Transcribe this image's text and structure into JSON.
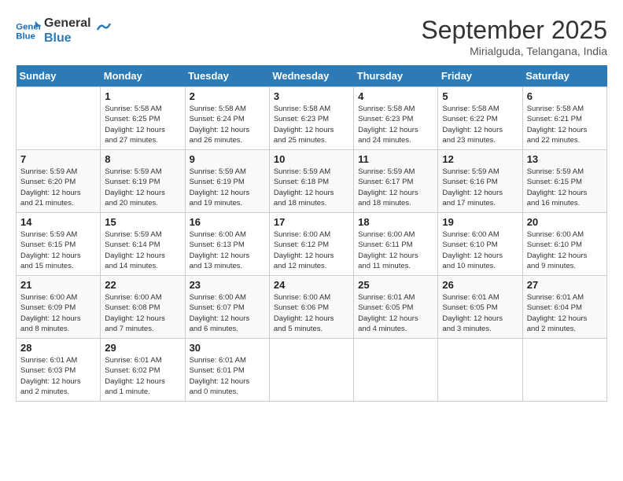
{
  "header": {
    "logo_line1": "General",
    "logo_line2": "Blue",
    "month": "September 2025",
    "location": "Mirialguda, Telangana, India"
  },
  "columns": [
    "Sunday",
    "Monday",
    "Tuesday",
    "Wednesday",
    "Thursday",
    "Friday",
    "Saturday"
  ],
  "weeks": [
    [
      {
        "day": "",
        "info": ""
      },
      {
        "day": "1",
        "info": "Sunrise: 5:58 AM\nSunset: 6:25 PM\nDaylight: 12 hours\nand 27 minutes."
      },
      {
        "day": "2",
        "info": "Sunrise: 5:58 AM\nSunset: 6:24 PM\nDaylight: 12 hours\nand 26 minutes."
      },
      {
        "day": "3",
        "info": "Sunrise: 5:58 AM\nSunset: 6:23 PM\nDaylight: 12 hours\nand 25 minutes."
      },
      {
        "day": "4",
        "info": "Sunrise: 5:58 AM\nSunset: 6:23 PM\nDaylight: 12 hours\nand 24 minutes."
      },
      {
        "day": "5",
        "info": "Sunrise: 5:58 AM\nSunset: 6:22 PM\nDaylight: 12 hours\nand 23 minutes."
      },
      {
        "day": "6",
        "info": "Sunrise: 5:58 AM\nSunset: 6:21 PM\nDaylight: 12 hours\nand 22 minutes."
      }
    ],
    [
      {
        "day": "7",
        "info": "Sunrise: 5:59 AM\nSunset: 6:20 PM\nDaylight: 12 hours\nand 21 minutes."
      },
      {
        "day": "8",
        "info": "Sunrise: 5:59 AM\nSunset: 6:19 PM\nDaylight: 12 hours\nand 20 minutes."
      },
      {
        "day": "9",
        "info": "Sunrise: 5:59 AM\nSunset: 6:19 PM\nDaylight: 12 hours\nand 19 minutes."
      },
      {
        "day": "10",
        "info": "Sunrise: 5:59 AM\nSunset: 6:18 PM\nDaylight: 12 hours\nand 18 minutes."
      },
      {
        "day": "11",
        "info": "Sunrise: 5:59 AM\nSunset: 6:17 PM\nDaylight: 12 hours\nand 18 minutes."
      },
      {
        "day": "12",
        "info": "Sunrise: 5:59 AM\nSunset: 6:16 PM\nDaylight: 12 hours\nand 17 minutes."
      },
      {
        "day": "13",
        "info": "Sunrise: 5:59 AM\nSunset: 6:15 PM\nDaylight: 12 hours\nand 16 minutes."
      }
    ],
    [
      {
        "day": "14",
        "info": "Sunrise: 5:59 AM\nSunset: 6:15 PM\nDaylight: 12 hours\nand 15 minutes."
      },
      {
        "day": "15",
        "info": "Sunrise: 5:59 AM\nSunset: 6:14 PM\nDaylight: 12 hours\nand 14 minutes."
      },
      {
        "day": "16",
        "info": "Sunrise: 6:00 AM\nSunset: 6:13 PM\nDaylight: 12 hours\nand 13 minutes."
      },
      {
        "day": "17",
        "info": "Sunrise: 6:00 AM\nSunset: 6:12 PM\nDaylight: 12 hours\nand 12 minutes."
      },
      {
        "day": "18",
        "info": "Sunrise: 6:00 AM\nSunset: 6:11 PM\nDaylight: 12 hours\nand 11 minutes."
      },
      {
        "day": "19",
        "info": "Sunrise: 6:00 AM\nSunset: 6:10 PM\nDaylight: 12 hours\nand 10 minutes."
      },
      {
        "day": "20",
        "info": "Sunrise: 6:00 AM\nSunset: 6:10 PM\nDaylight: 12 hours\nand 9 minutes."
      }
    ],
    [
      {
        "day": "21",
        "info": "Sunrise: 6:00 AM\nSunset: 6:09 PM\nDaylight: 12 hours\nand 8 minutes."
      },
      {
        "day": "22",
        "info": "Sunrise: 6:00 AM\nSunset: 6:08 PM\nDaylight: 12 hours\nand 7 minutes."
      },
      {
        "day": "23",
        "info": "Sunrise: 6:00 AM\nSunset: 6:07 PM\nDaylight: 12 hours\nand 6 minutes."
      },
      {
        "day": "24",
        "info": "Sunrise: 6:00 AM\nSunset: 6:06 PM\nDaylight: 12 hours\nand 5 minutes."
      },
      {
        "day": "25",
        "info": "Sunrise: 6:01 AM\nSunset: 6:05 PM\nDaylight: 12 hours\nand 4 minutes."
      },
      {
        "day": "26",
        "info": "Sunrise: 6:01 AM\nSunset: 6:05 PM\nDaylight: 12 hours\nand 3 minutes."
      },
      {
        "day": "27",
        "info": "Sunrise: 6:01 AM\nSunset: 6:04 PM\nDaylight: 12 hours\nand 2 minutes."
      }
    ],
    [
      {
        "day": "28",
        "info": "Sunrise: 6:01 AM\nSunset: 6:03 PM\nDaylight: 12 hours\nand 2 minutes."
      },
      {
        "day": "29",
        "info": "Sunrise: 6:01 AM\nSunset: 6:02 PM\nDaylight: 12 hours\nand 1 minute."
      },
      {
        "day": "30",
        "info": "Sunrise: 6:01 AM\nSunset: 6:01 PM\nDaylight: 12 hours\nand 0 minutes."
      },
      {
        "day": "",
        "info": ""
      },
      {
        "day": "",
        "info": ""
      },
      {
        "day": "",
        "info": ""
      },
      {
        "day": "",
        "info": ""
      }
    ]
  ]
}
